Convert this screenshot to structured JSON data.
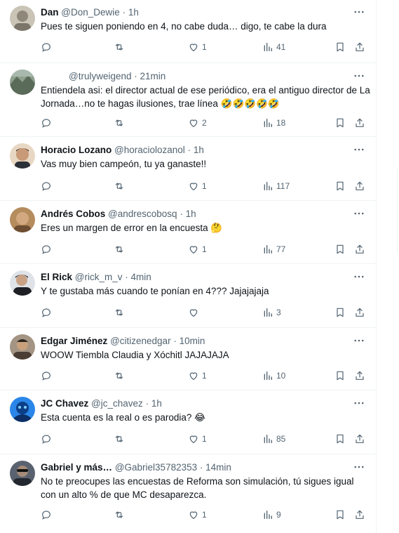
{
  "tweets": [
    {
      "name": "Dan",
      "handle": "@Don_Dewie",
      "time": "1h",
      "text": "Pues te siguen poniendo en 4, no cabe duda… digo, te cabe la dura",
      "emoji": "",
      "likes": "1",
      "views": "41",
      "avatar_color": "#b9b3a4"
    },
    {
      "name": "",
      "handle": "@trulyweigend",
      "time": "21min",
      "text": "Entiendela asi: el director actual de ese periódico, era el antiguo director de La Jornada…no te hagas ilusiones, trae línea",
      "emoji": "🤣🤣🤣🤣🤣",
      "likes": "2",
      "views": "18",
      "avatar_color": "#6d7f73"
    },
    {
      "name": "Horacio Lozano",
      "handle": "@horaciolozanol",
      "time": "1h",
      "text": "Vas muy bien campeón, tu ya ganaste!!",
      "emoji": "",
      "likes": "1",
      "views": "117",
      "avatar_color": "#d9c2a8"
    },
    {
      "name": "Andrés Cobos",
      "handle": "@andrescobosq",
      "time": "1h",
      "text": "Eres un margen de error en la encuesta",
      "emoji": "🤔",
      "likes": "1",
      "views": "77",
      "avatar_color": "#a07a52"
    },
    {
      "name": "El Rick",
      "handle": "@rick_m_v",
      "time": "4min",
      "text": "Y te gustaba más cuando te ponían en 4??? Jajajajaja",
      "emoji": "",
      "likes": "",
      "views": "3",
      "avatar_color": "#3b4250"
    },
    {
      "name": "Edgar Jiménez",
      "handle": "@citizenedgar",
      "time": "10min",
      "text": "WOOW Tiembla Claudia y Xóchitl JAJAJAJA",
      "emoji": "",
      "likes": "1",
      "views": "10",
      "avatar_color": "#6b5a48"
    },
    {
      "name": "JC Chavez",
      "handle": "@jc_chavez",
      "time": "1h",
      "text": "Esta cuenta es la real o es parodia?",
      "emoji": "😂",
      "likes": "1",
      "views": "85",
      "avatar_color": "#1f6fd1"
    },
    {
      "name": "Gabriel y más…",
      "handle": "@Gabriel35782353",
      "time": "14min",
      "text": "No te preocupes las encuestas de Reforma son simulación, tú sigues igual con un alto % de que MC desaparezca.",
      "emoji": "",
      "likes": "1",
      "views": "9",
      "avatar_color": "#3a3f48"
    }
  ],
  "separator": "·"
}
